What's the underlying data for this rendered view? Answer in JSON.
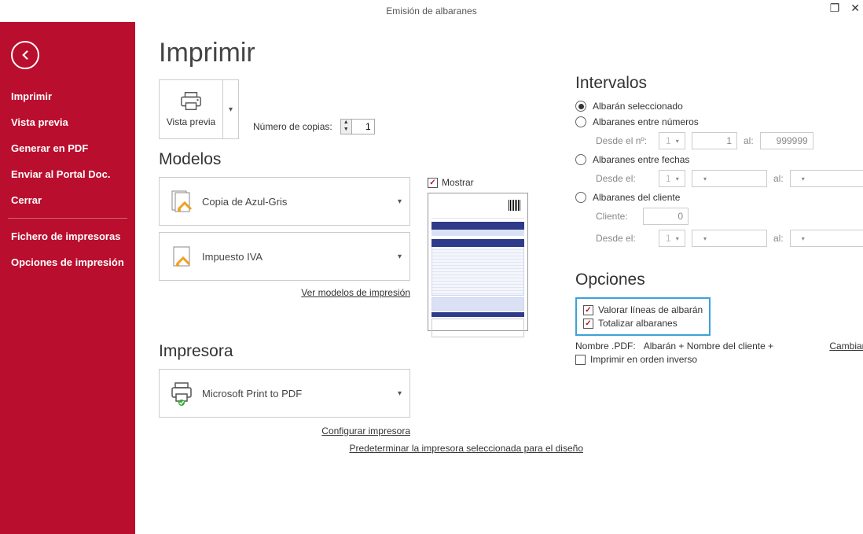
{
  "window": {
    "title": "Emisión de albaranes"
  },
  "sidebar": {
    "items": [
      {
        "label": "Imprimir"
      },
      {
        "label": "Vista previa"
      },
      {
        "label": "Generar en PDF"
      },
      {
        "label": "Enviar al Portal Doc."
      },
      {
        "label": "Cerrar"
      }
    ],
    "bottom": [
      {
        "label": "Fichero de impresoras"
      },
      {
        "label": "Opciones de impresión"
      }
    ]
  },
  "page": {
    "title": "Imprimir",
    "vista_previa": "Vista previa",
    "copies_label": "Número de copias:",
    "copies_value": "1"
  },
  "modelos": {
    "heading": "Modelos",
    "mostrar_label": "Mostrar",
    "mostrar_checked": true,
    "model1": "Copia de Azul-Gris",
    "model2": "Impuesto IVA",
    "link": "Ver modelos de impresión"
  },
  "impresora": {
    "heading": "Impresora",
    "selected": "Microsoft Print to PDF",
    "link_config": "Configurar impresora",
    "link_default": "Predeterminar la impresora seleccionada para el diseño"
  },
  "intervalos": {
    "heading": "Intervalos",
    "r1": {
      "label": "Albarán seleccionado",
      "checked": true
    },
    "r2": {
      "label": "Albaranes entre números",
      "checked": false,
      "desde_lbl": "Desde el nº:",
      "serie": "1",
      "desde": "1",
      "al_lbl": "al:",
      "hasta": "999999"
    },
    "r3": {
      "label": "Albaranes entre fechas",
      "checked": false,
      "desde_lbl": "Desde el:",
      "serie": "1",
      "al_lbl": "al:"
    },
    "r4": {
      "label": "Albaranes del cliente",
      "checked": false,
      "cliente_lbl": "Cliente:",
      "cliente_val": "0",
      "desde_lbl": "Desde el:",
      "serie": "1",
      "al_lbl": "al:"
    }
  },
  "opciones": {
    "heading": "Opciones",
    "valorar": {
      "label": "Valorar líneas de albarán",
      "checked": true
    },
    "totalizar": {
      "label": "Totalizar albaranes",
      "checked": true
    },
    "pdf_label": "Nombre .PDF:",
    "pdf_value": "Albarán + Nombre del cliente +",
    "cambiar": "Cambiar",
    "inverso": {
      "label": "Imprimir en orden inverso",
      "checked": false
    }
  }
}
